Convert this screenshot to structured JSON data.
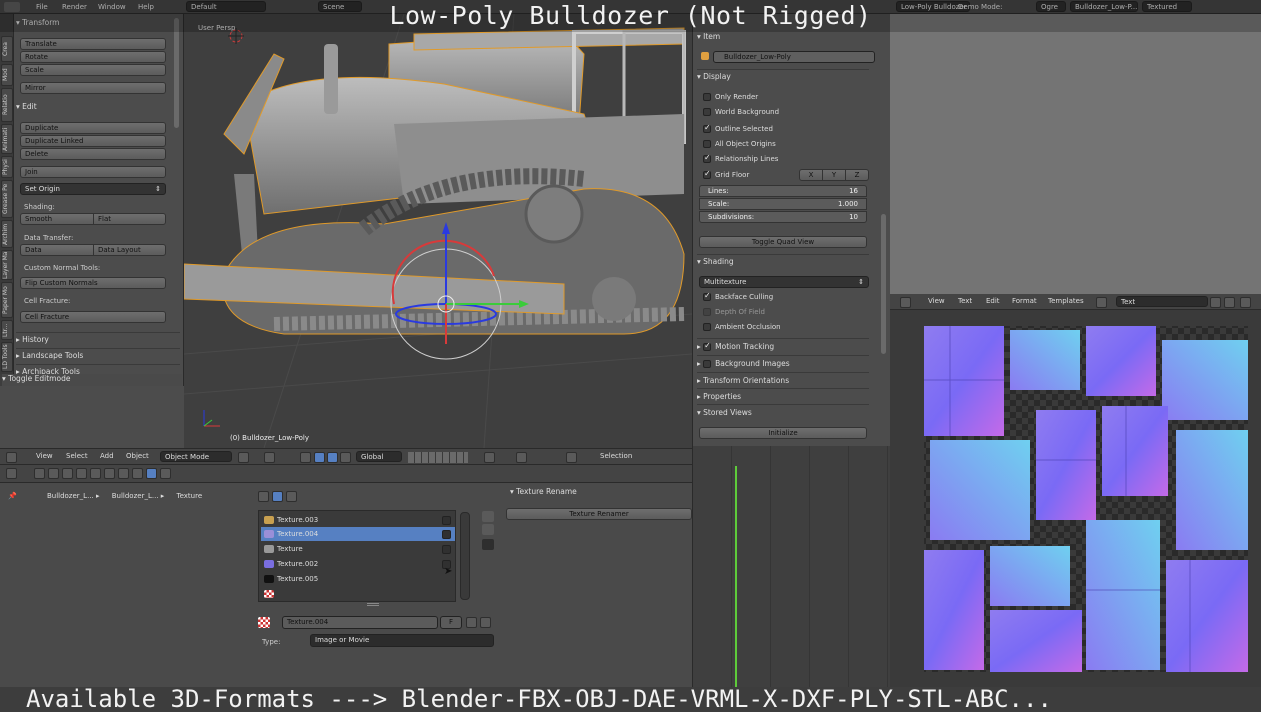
{
  "topbar": {
    "menus": [
      "File",
      "Render",
      "Window",
      "Help"
    ],
    "screen_layout": "Default",
    "scene": "Scene",
    "engine": "Low-Poly Bulldozer",
    "demo_mode": "Demo Mode:",
    "ogre": "Ogre",
    "active_object": "Bulldozer_Low-P...",
    "viewport_shading": "Textured"
  },
  "overlay": {
    "title": "Low-Poly Bulldozer (Not Rigged)",
    "bottom": "Available 3D-Formats ---> Blender-FBX-OBJ-DAE-VRML-X-DXF-PLY-STL-ABC..."
  },
  "side_tabs": [
    "Crea",
    "Mod",
    "Relatio",
    "Animati",
    "Physi",
    "Grease Pe",
    "Archim",
    "Layer Ma",
    "Paper Mo",
    "Ltr...",
    "LD Tools"
  ],
  "toolshelf": {
    "transform_header": "Transform",
    "translate": "Translate",
    "rotate": "Rotate",
    "scale": "Scale",
    "mirror": "Mirror",
    "edit_header": "Edit",
    "duplicate": "Duplicate",
    "duplicate_linked": "Duplicate Linked",
    "delete": "Delete",
    "join": "Join",
    "set_origin": "Set Origin",
    "shading_label": "Shading:",
    "smooth": "Smooth",
    "flat": "Flat",
    "data_transfer_label": "Data Transfer:",
    "data": "Data",
    "data_layout": "Data Layout",
    "custom_normals_label": "Custom Normal Tools:",
    "flip_custom_normals": "Flip Custom Normals",
    "cell_fracture_label": "Cell Fracture:",
    "cell_fracture": "Cell Fracture",
    "history": "History",
    "landscape_tools": "Landscape Tools",
    "archipack_tools": "Archipack Tools",
    "toggle_editmode": "Toggle Editmode"
  },
  "viewport": {
    "view_label": "User Persp",
    "object_label": "(0) Bulldozer_Low-Poly"
  },
  "npanel": {
    "item_header": "Item",
    "object_name": "Bulldozer_Low-Poly",
    "display_header": "Display",
    "only_render": "Only Render",
    "world_background": "World Background",
    "outline_selected": "Outline Selected",
    "all_object_origins": "All Object Origins",
    "relationship_lines": "Relationship Lines",
    "grid_floor": "Grid Floor",
    "axis_x": "X",
    "axis_y": "Y",
    "axis_z": "Z",
    "lines_label": "Lines:",
    "lines_value": "16",
    "scale_label": "Scale:",
    "scale_value": "1.000",
    "subdivisions_label": "Subdivisions:",
    "subdivisions_value": "10",
    "toggle_quad_view": "Toggle Quad View",
    "shading_header": "Shading",
    "shading_mode": "Multitexture",
    "backface_culling": "Backface Culling",
    "depth_of_field": "Depth Of Field",
    "ambient_occlusion": "Ambient Occlusion",
    "motion_tracking": "Motion Tracking",
    "background_images": "Background Images",
    "transform_orientations": "Transform Orientations",
    "properties": "Properties",
    "stored_views": "Stored Views",
    "initialize": "Initialize"
  },
  "viewport_header": {
    "view": "View",
    "select": "Select",
    "add": "Add",
    "object": "Object",
    "mode": "Object Mode",
    "orientation": "Global",
    "selection": "Selection"
  },
  "properties_panel": {
    "breadcrumb": [
      "Bulldozer_L...",
      "Bulldozer_L...",
      "Texture"
    ],
    "textures": [
      {
        "name": "Texture.003",
        "icon_color": "#c8a050",
        "selected": false
      },
      {
        "name": "Texture.004",
        "icon_color": "#9a8fd8",
        "selected": true
      },
      {
        "name": "Texture",
        "icon_color": "#999999",
        "selected": false
      },
      {
        "name": "Texture.002",
        "icon_color": "#7a6ee0",
        "selected": false
      },
      {
        "name": "Texture.005",
        "icon_color": "#111111",
        "selected": false
      }
    ],
    "active_texture": "Texture.004",
    "fake_user": "F",
    "type_label": "Type:",
    "type_value": "Image or Movie",
    "texture_rename_header": "Texture Rename",
    "texture_renamer_button": "Texture Renamer"
  },
  "image_editor_header": {
    "view": "View",
    "text": "Text",
    "edit": "Edit",
    "format": "Format",
    "templates": "Templates",
    "datablock": "Text"
  },
  "colors": {
    "accent": "#5680c2",
    "timeline_frame": "#5ecb3a"
  }
}
